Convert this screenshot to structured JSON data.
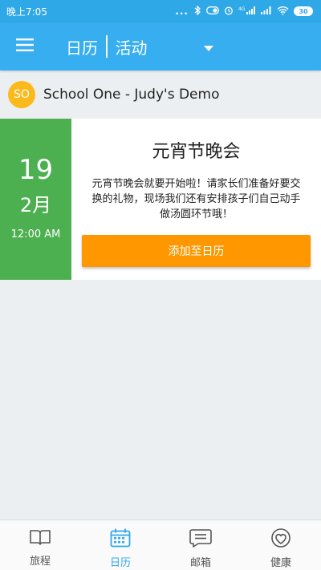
{
  "status_bar": {
    "time": "晚上7:05",
    "dots": "...",
    "network": "4G",
    "battery": "30"
  },
  "app_bar": {
    "title_left": "日历",
    "title_right": "活动"
  },
  "school": {
    "avatar_initials": "SO",
    "name": "School One - Judy's Demo"
  },
  "event": {
    "day": "19",
    "month": "2月",
    "time": "12:00 AM",
    "title": "元宵节晚会",
    "description": "元宵节晚会就要开始啦！请家长们准备好要交换的礼物，现场我们还有安排孩子们自己动手做汤圆环节哦！",
    "add_button_label": "添加至日历"
  },
  "bottom_nav": {
    "items": [
      {
        "label": "旅程",
        "icon": "book-icon"
      },
      {
        "label": "日历",
        "icon": "calendar-icon"
      },
      {
        "label": "邮箱",
        "icon": "message-icon"
      },
      {
        "label": "健康",
        "icon": "heart-icon"
      }
    ],
    "active_index": 1
  },
  "colors": {
    "primary": "#37aef0",
    "status_bar": "#2fa8e8",
    "date_block": "#4caf50",
    "add_button": "#ff9800",
    "avatar": "#fcb91b"
  }
}
